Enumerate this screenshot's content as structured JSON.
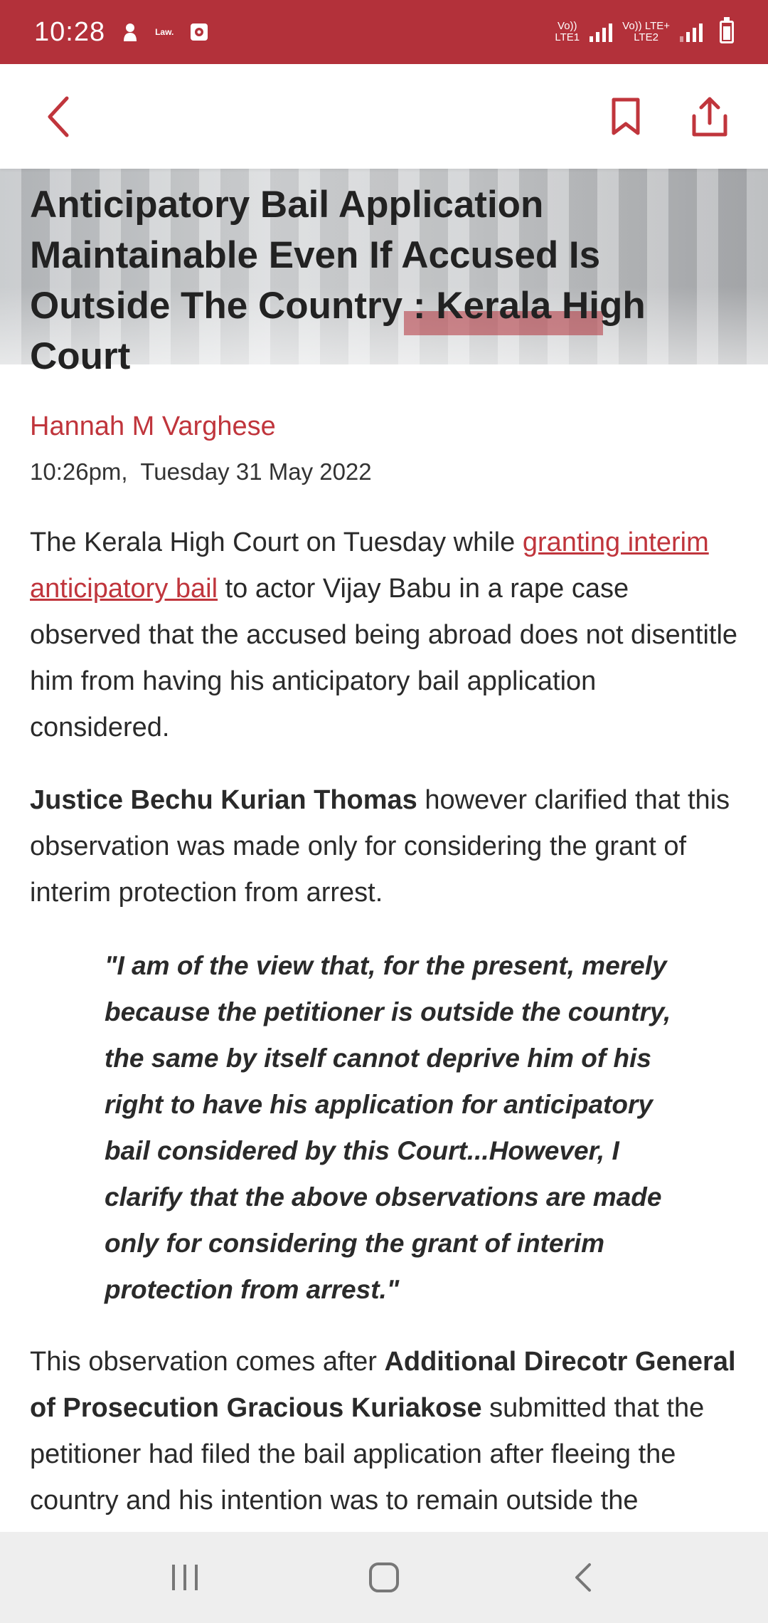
{
  "status_bar": {
    "time": "10:28",
    "law_icon_text": "Law.",
    "net1": "Vo))\nLTE1",
    "net2": "Vo)) LTE+\nLTE2",
    "icons": [
      "notification-icon",
      "law-app-icon",
      "media-icon",
      "signal-icon",
      "battery-icon"
    ]
  },
  "toolbar": {
    "back_icon": "chevron-left-icon",
    "bookmark_icon": "bookmark-icon",
    "share_icon": "share-icon",
    "accent_color": "#c0353c"
  },
  "article": {
    "title": "Anticipatory Bail Application Maintainable Even If Accused Is Outside The Country : Kerala High Court",
    "author": "Hannah M Varghese",
    "date": "10:26pm,  Tuesday 31 May 2022",
    "p1_before": "The Kerala High Court on Tuesday while ",
    "p1_link": "granting interim anticipatory bail",
    "p1_after": " to actor Vijay Babu in a rape case observed that the accused being abroad does not disentitle him from having his anticipatory bail application considered.",
    "p2_bold": "Justice Bechu Kurian Thomas",
    "p2_rest": " however clarified that this observation was made only for considering the grant of interim protection from arrest.",
    "quote": "\"I am of the view that, for the present, merely because the petitioner is outside the country, the same by itself cannot deprive him of his right to have his application for anticipatory bail considered by this Court...However, I clarify that the above observations are made only for considering the grant of interim protection from arrest.\"",
    "p3_before": "This observation comes after ",
    "p3_bold": "Additional Direcotr General of Prosecution Gracious Kuriakose",
    "p3_after": " submitted that the petitioner had filed the bail application after fleeing the country and his intention was to remain outside the jurisdiction only to thwart the investigation. The"
  },
  "nav_bar": {
    "icons": [
      "recent-apps-icon",
      "home-icon",
      "back-icon"
    ]
  }
}
